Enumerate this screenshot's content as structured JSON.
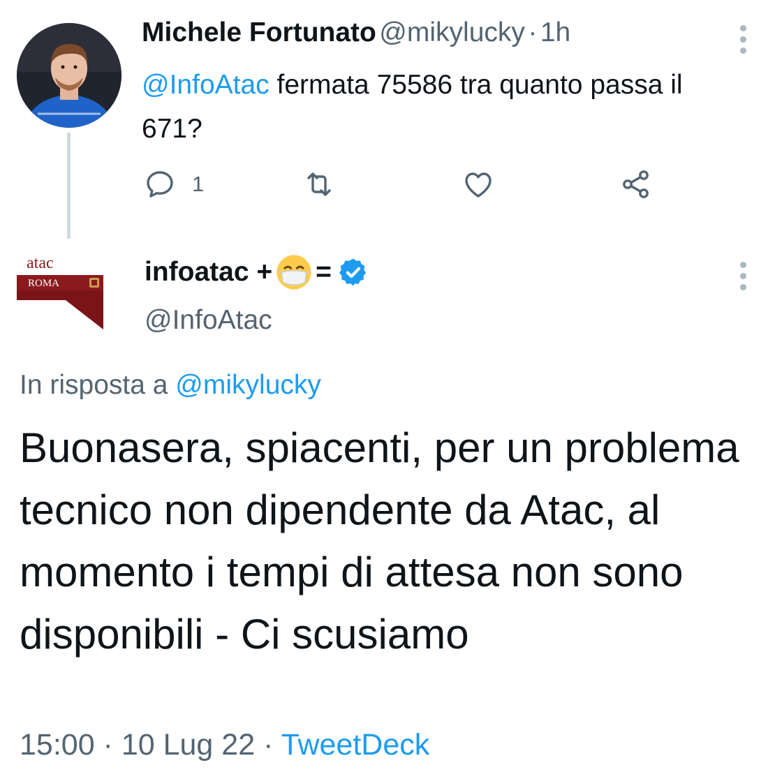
{
  "tweet1": {
    "display_name": "Michele Fortunato",
    "handle": "@mikylucky",
    "separator": "·",
    "time": "1h",
    "mention": "@InfoAtac",
    "text": " fermata 75586 tra quanto passa il 671?",
    "reply_count": "1"
  },
  "tweet2": {
    "display_name_prefix": "infoatac +",
    "display_name_suffix": "=",
    "handle": "@InfoAtac",
    "logo_text": "atac",
    "logo_subtext": "ROMA",
    "reply_prefix": "In risposta a ",
    "reply_handle": "@mikylucky",
    "text": "Buonasera, spiacenti, per un problema tecnico non dipendente da Atac, al momento i tempi di attesa non sono disponibili - Ci scusiamo",
    "time": "15:00",
    "separator1": " · ",
    "date": "10 Lug 22",
    "separator2": " · ",
    "source": "TweetDeck"
  },
  "colors": {
    "link": "#1d9bf0",
    "secondary_text": "#536471",
    "verified": "#1d9bf0",
    "atac_red": "#8b1a1f"
  },
  "icons": [
    "reply-icon",
    "retweet-icon",
    "like-icon",
    "share-icon",
    "more-icon",
    "verified-badge-icon",
    "mask-emoji-icon"
  ]
}
